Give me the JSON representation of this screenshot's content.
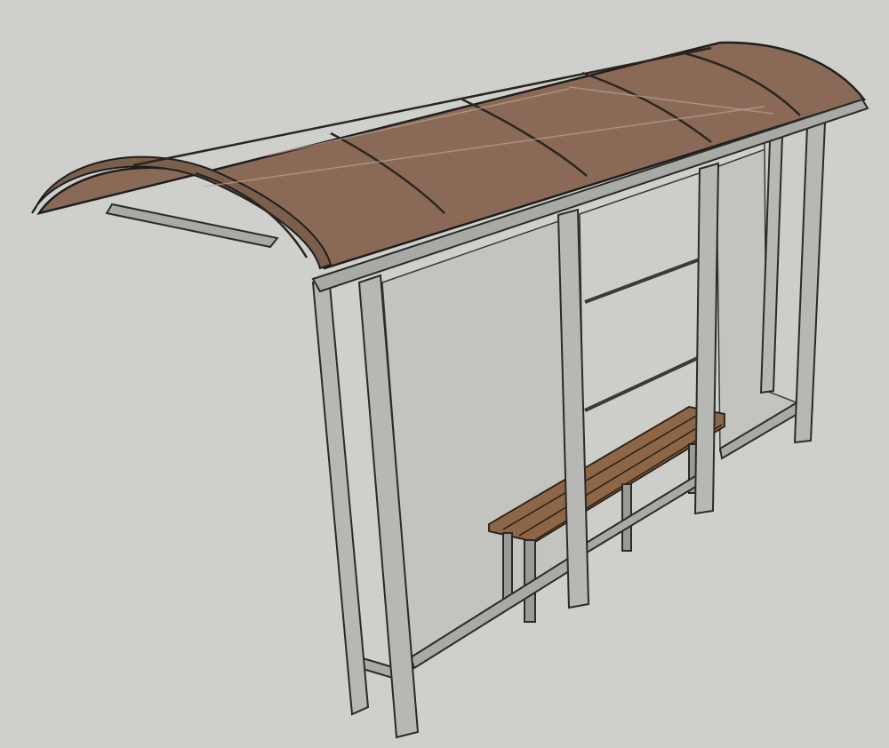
{
  "scene": {
    "subject": "bus-stop-shelter",
    "colors": {
      "background": "#cfd0cb",
      "roof": "#8a6a57",
      "frame": "#b7b8b4",
      "glass": "#c3c3c0",
      "bench": "#8c6646"
    }
  }
}
